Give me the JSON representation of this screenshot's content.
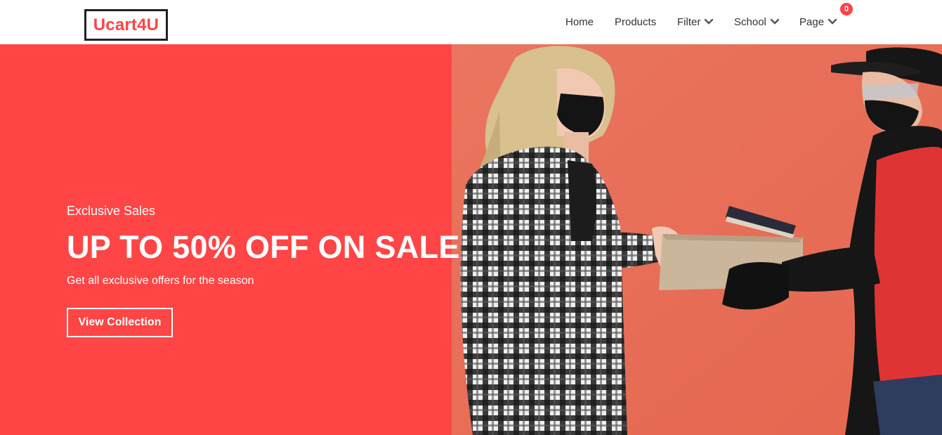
{
  "brand": {
    "logo_text": "Ucart4U",
    "accent": "#ff4444"
  },
  "nav": {
    "items": [
      {
        "label": "Home",
        "dropdown": false
      },
      {
        "label": "Products",
        "dropdown": false
      },
      {
        "label": "Filter",
        "dropdown": true
      },
      {
        "label": "School",
        "dropdown": true
      },
      {
        "label": "Page",
        "dropdown": true
      }
    ],
    "cart_count": "0"
  },
  "hero": {
    "kicker": "Exclusive Sales",
    "title": "UP TO 50% OFF ON SALE",
    "subtitle": "Get all exclusive offers for the season",
    "button_label": "View Collection",
    "left_bg": "#ff4545",
    "photo_bg": "#e9705c"
  }
}
